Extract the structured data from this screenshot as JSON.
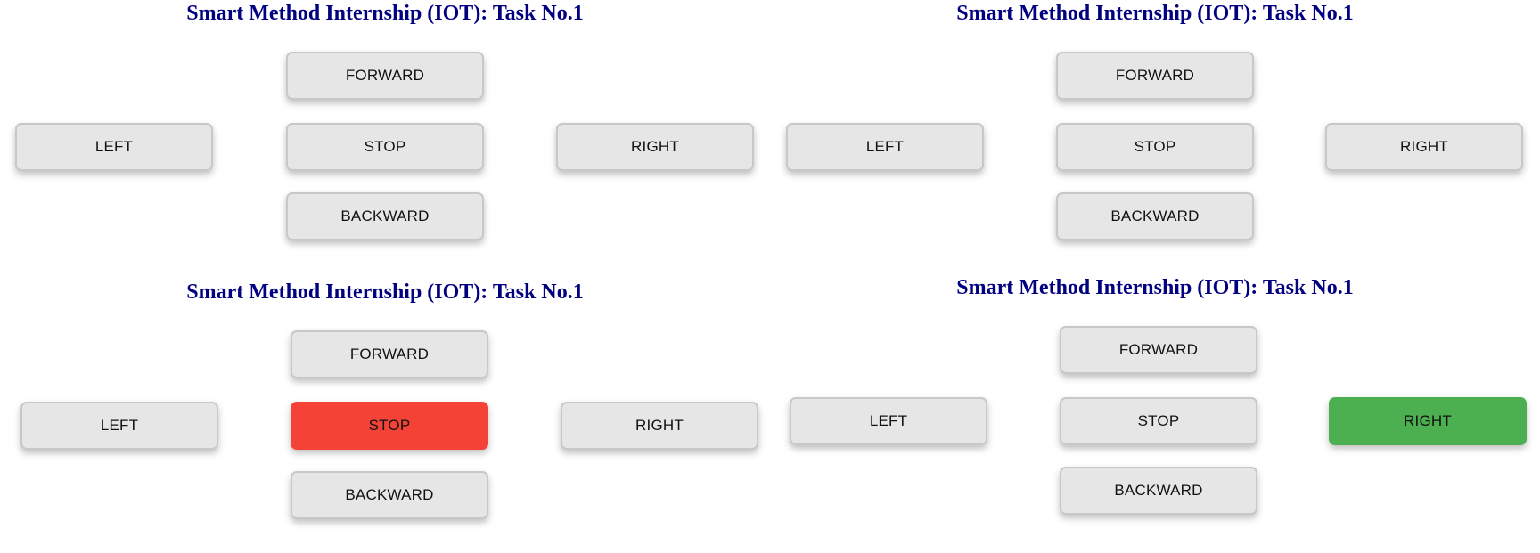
{
  "panels": [
    {
      "title": "Smart Method Internship (IOT): Task No.1",
      "buttons": {
        "forward": "FORWARD",
        "left": "LEFT",
        "stop": "STOP",
        "right": "RIGHT",
        "backward": "BACKWARD"
      },
      "active": "none"
    },
    {
      "title": "Smart Method Internship (IOT): Task No.1",
      "buttons": {
        "forward": "FORWARD",
        "left": "LEFT",
        "stop": "STOP",
        "right": "RIGHT",
        "backward": "BACKWARD"
      },
      "active": "none"
    },
    {
      "title": "Smart Method Internship (IOT): Task No.1",
      "buttons": {
        "forward": "FORWARD",
        "left": "LEFT",
        "stop": "STOP",
        "right": "RIGHT",
        "backward": "BACKWARD"
      },
      "active": "stop"
    },
    {
      "title": "Smart Method Internship (IOT): Task No.1",
      "buttons": {
        "forward": "FORWARD",
        "left": "LEFT",
        "stop": "STOP",
        "right": "RIGHT",
        "backward": "BACKWARD"
      },
      "active": "right"
    }
  ],
  "colors": {
    "title": "#000080",
    "button_default": "#e6e6e6",
    "button_stop_active": "#f44336",
    "button_right_active": "#4caf50"
  }
}
